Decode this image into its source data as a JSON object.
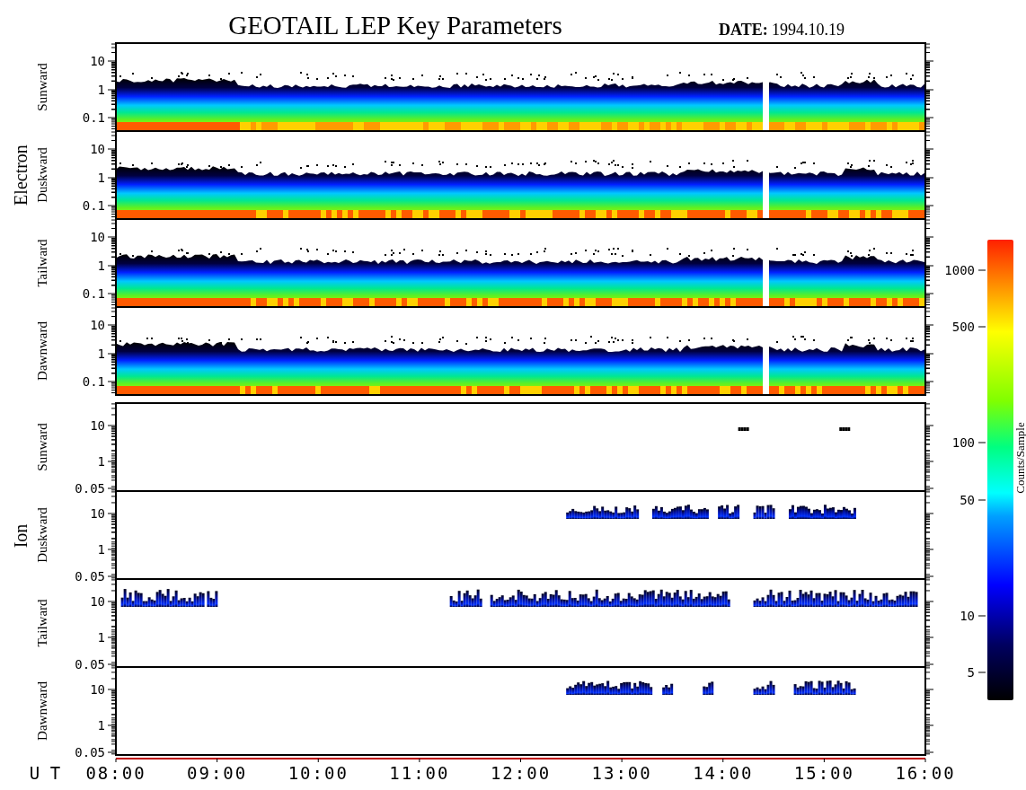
{
  "title": "GEOTAIL LEP Key Parameters",
  "date_label": "DATE:",
  "date": "1994.10.19",
  "groups": [
    {
      "species": "Electron",
      "panels": [
        {
          "direction": "Sunward",
          "kind": "band",
          "yticks": [
            "10",
            "1",
            "0.1"
          ]
        },
        {
          "direction": "Duskward",
          "kind": "band",
          "yticks": [
            "10",
            "1",
            "0.1"
          ]
        },
        {
          "direction": "Tailward",
          "kind": "band",
          "yticks": [
            "10",
            "1",
            "0.1"
          ]
        },
        {
          "direction": "Dawnward",
          "kind": "band",
          "yticks": [
            "10",
            "1",
            "0.1"
          ]
        }
      ]
    },
    {
      "species": "Ion",
      "panels": [
        {
          "direction": "Sunward",
          "kind": "specks",
          "yticks": [
            "10",
            "1",
            "0.05"
          ]
        },
        {
          "direction": "Duskward",
          "kind": "late",
          "yticks": [
            "10",
            "1",
            "0.05"
          ]
        },
        {
          "direction": "Tailward",
          "kind": "full",
          "yticks": [
            "10",
            "1",
            "0.05"
          ]
        },
        {
          "direction": "Dawnward",
          "kind": "later",
          "yticks": [
            "10",
            "1",
            "0.05"
          ]
        }
      ]
    }
  ],
  "x_axis": {
    "label": "U T",
    "ticks": [
      "08:00",
      "09:00",
      "10:00",
      "11:00",
      "12:00",
      "13:00",
      "14:00",
      "15:00",
      "16:00"
    ]
  },
  "colorbar": {
    "label": "Counts/Sample",
    "ticks": [
      "1000",
      "500",
      "100",
      "50",
      "10",
      "5"
    ]
  }
}
